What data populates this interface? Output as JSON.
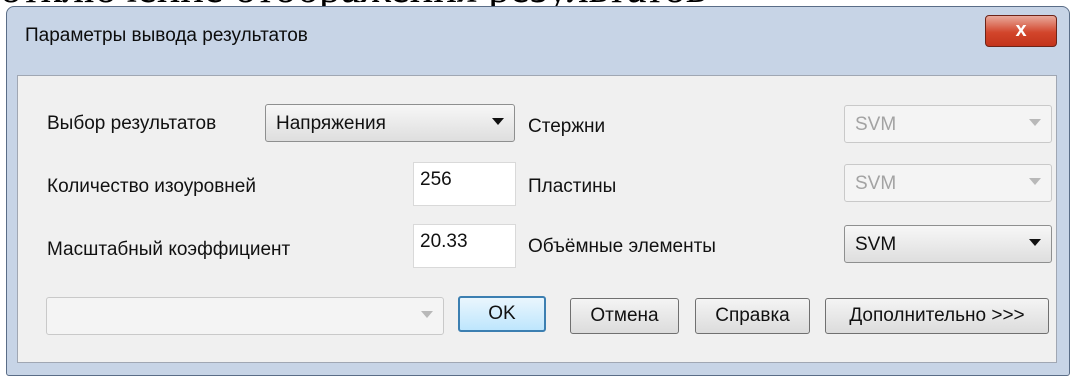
{
  "background_text": "отключение отображения результатов",
  "dialog": {
    "title": "Параметры вывода результатов",
    "close_label": "x"
  },
  "fields": {
    "result_label": "Выбор результатов",
    "result_value": "Напряжения",
    "isolevels_label": "Количество изоуровней",
    "isolevels_value": "256",
    "scale_label": "Масштабный коэффициент",
    "scale_value": "20.33"
  },
  "elements": {
    "rods_label": "Стержни",
    "rods_value": "SVM",
    "plates_label": "Пластины",
    "plates_value": "SVM",
    "volume_label": "Объёмные элементы",
    "volume_value": "SVM"
  },
  "bottom": {
    "empty_combo_value": "",
    "ok_label": "OK",
    "cancel_label": "Отмена",
    "help_label": "Справка",
    "more_label": "Дополнительно >>>"
  }
}
